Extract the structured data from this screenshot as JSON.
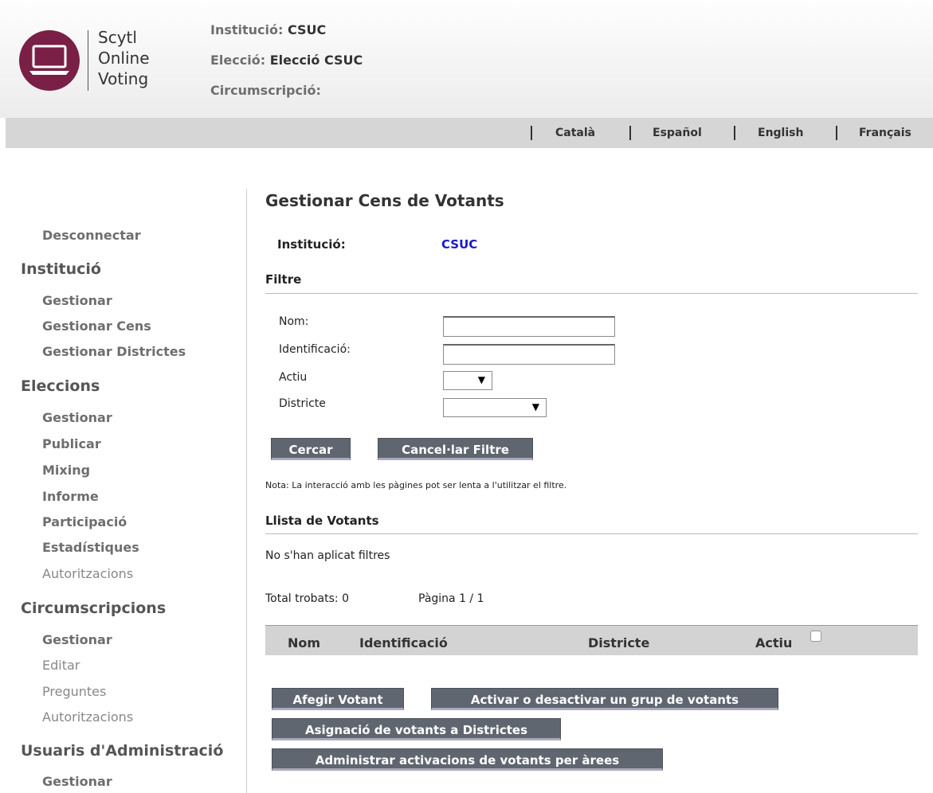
{
  "logo": {
    "lines": [
      "Scytl",
      "Online",
      "Voting"
    ]
  },
  "header": {
    "institution_label": "Institució:",
    "institution_value": "CSUC",
    "election_label": "Elecció:",
    "election_value": "Elecció CSUC",
    "district_label": "Circumscripció:"
  },
  "languages": [
    "Català",
    "Español",
    "English",
    "Français"
  ],
  "sidebar": {
    "logout": "Desconnectar",
    "institution": {
      "title": "Institució",
      "items": [
        "Gestionar",
        "Gestionar Cens",
        "Gestionar Districtes"
      ]
    },
    "elections": {
      "title": "Eleccions",
      "items": [
        "Gestionar",
        "Publicar",
        "Mixing",
        "Informe",
        "Participació",
        "Estadístiques",
        "Autoritzacions"
      ]
    },
    "districts": {
      "title": "Circumscripcions",
      "items": [
        "Gestionar",
        "Editar",
        "Preguntes",
        "Autoritzacions"
      ]
    },
    "admin_users": {
      "title": "Usuaris d'Administració",
      "items": [
        "Gestionar"
      ]
    }
  },
  "main": {
    "title": "Gestionar Cens de Votants",
    "institution_label": "Institució:",
    "institution_value": "CSUC",
    "filter": {
      "title": "Filtre",
      "name_label": "Nom:",
      "name_value": "",
      "id_label": "Identificació:",
      "id_value": "",
      "active_label": "Actiu",
      "active_value": "",
      "district_label": "Districte",
      "district_value": "",
      "search_button": "Cercar",
      "cancel_button": "Cancel·lar Filtre",
      "note": "Nota: La interacció amb les pàgines pot ser lenta a l'utilitzar el filtre."
    },
    "voters": {
      "title": "Llista de Votants",
      "no_filters": "No s'han aplicat filtres",
      "total": "Total trobats: 0",
      "page": "Pàgina 1 / 1",
      "columns": [
        "Nom",
        "Identificació",
        "Districte",
        "Actiu"
      ]
    },
    "buttons": {
      "add_voter": "Afegir Votant",
      "toggle_group": "Activar o desactivar un grup de votants",
      "assign_districts": "Asignació de votants a Districtes",
      "manage_activations": "Administrar activacions de votants per àrees"
    }
  },
  "colors": {
    "brand": "#7a1f45",
    "button": "#5f6670",
    "link": "#1a1acc"
  }
}
